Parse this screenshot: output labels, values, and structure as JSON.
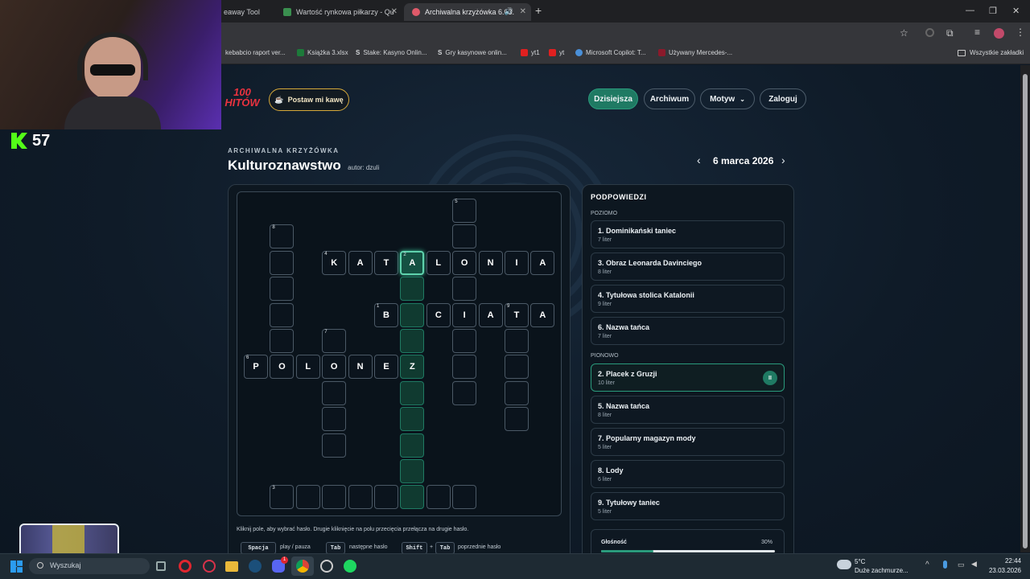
{
  "browser": {
    "tabs": [
      {
        "label": "eaway Tool",
        "color": "#6b7280"
      },
      {
        "label": "Wartość rynkowa piłkarzy - Qu",
        "color": "#3a8f4f"
      },
      {
        "label": "Archiwalna krzyżówka 6.03.",
        "color": "#e05a6a"
      }
    ],
    "new_tab": "+",
    "bookmarks": [
      {
        "label": "kebabcio raport ver...",
        "color": "#444"
      },
      {
        "label": "Książka 3.xlsx",
        "color": "#1d7a3a"
      },
      {
        "label": "Stake: Kasyno Onlin...",
        "color": "#555"
      },
      {
        "label": "Gry kasynowe onlin...",
        "color": "#555"
      },
      {
        "label": "yt1",
        "color": "#e02020"
      },
      {
        "label": "yt",
        "color": "#e02020"
      },
      {
        "label": "Microsoft Copilot: T...",
        "color": "#4a90d9"
      },
      {
        "label": "Używany Mercedes-...",
        "color": "#8b1a2b"
      }
    ],
    "all_bookmarks": "Wszystkie zakładki"
  },
  "stream": {
    "score": "57"
  },
  "header": {
    "logo": "100 HITÓW",
    "coffee": "Postaw mi kawę",
    "nav": [
      "Dzisiejsza",
      "Archiwum",
      "Motyw",
      "Zaloguj"
    ]
  },
  "puzzle": {
    "eyebrow": "ARCHIWALNA KRZYŻÓWKA",
    "title": "Kulturoznawstwo",
    "author": "autor: dzuli",
    "date": "6 marca 2026",
    "prev": "‹",
    "next": "›"
  },
  "grid": {
    "cells": [
      {
        "r": 0,
        "c": 8,
        "n": "5"
      },
      {
        "r": 1,
        "c": 1,
        "n": "8"
      },
      {
        "r": 1,
        "c": 8
      },
      {
        "r": 2,
        "c": 1
      },
      {
        "r": 2,
        "c": 3,
        "n": "4",
        "l": "K"
      },
      {
        "r": 2,
        "c": 4,
        "l": "A"
      },
      {
        "r": 2,
        "c": 5,
        "l": "T"
      },
      {
        "r": 2,
        "c": 6,
        "n": "2",
        "l": "A",
        "s": "sel"
      },
      {
        "r": 2,
        "c": 7,
        "l": "L"
      },
      {
        "r": 2,
        "c": 8,
        "l": "O"
      },
      {
        "r": 2,
        "c": 9,
        "l": "N"
      },
      {
        "r": 2,
        "c": 10,
        "l": "I"
      },
      {
        "r": 2,
        "c": 11,
        "l": "A"
      },
      {
        "r": 3,
        "c": 1
      },
      {
        "r": 3,
        "c": 6,
        "s": "hl"
      },
      {
        "r": 3,
        "c": 8
      },
      {
        "r": 4,
        "c": 1
      },
      {
        "r": 4,
        "c": 5,
        "n": "1",
        "l": "B"
      },
      {
        "r": 4,
        "c": 6,
        "s": "hl"
      },
      {
        "r": 4,
        "c": 7,
        "l": "C"
      },
      {
        "r": 4,
        "c": 8,
        "l": "I"
      },
      {
        "r": 4,
        "c": 9,
        "l": "A"
      },
      {
        "r": 4,
        "c": 10,
        "n": "9",
        "l": "T"
      },
      {
        "r": 4,
        "c": 11,
        "l": "A"
      },
      {
        "r": 5,
        "c": 1
      },
      {
        "r": 5,
        "c": 3,
        "n": "7"
      },
      {
        "r": 5,
        "c": 6,
        "s": "hl"
      },
      {
        "r": 5,
        "c": 8
      },
      {
        "r": 5,
        "c": 10
      },
      {
        "r": 6,
        "c": 0,
        "n": "6",
        "l": "P"
      },
      {
        "r": 6,
        "c": 1,
        "l": "O"
      },
      {
        "r": 6,
        "c": 2,
        "l": "L"
      },
      {
        "r": 6,
        "c": 3,
        "l": "O"
      },
      {
        "r": 6,
        "c": 4,
        "l": "N"
      },
      {
        "r": 6,
        "c": 5,
        "l": "E"
      },
      {
        "r": 6,
        "c": 6,
        "l": "Z",
        "s": "hl"
      },
      {
        "r": 6,
        "c": 8
      },
      {
        "r": 6,
        "c": 10
      },
      {
        "r": 7,
        "c": 3
      },
      {
        "r": 7,
        "c": 6,
        "s": "hl"
      },
      {
        "r": 7,
        "c": 8
      },
      {
        "r": 7,
        "c": 10
      },
      {
        "r": 8,
        "c": 3
      },
      {
        "r": 8,
        "c": 6,
        "s": "hl"
      },
      {
        "r": 8,
        "c": 10
      },
      {
        "r": 9,
        "c": 3
      },
      {
        "r": 9,
        "c": 6,
        "s": "hl"
      },
      {
        "r": 10,
        "c": 6,
        "s": "hl"
      },
      {
        "r": 11,
        "c": 1,
        "n": "3"
      },
      {
        "r": 11,
        "c": 2
      },
      {
        "r": 11,
        "c": 3
      },
      {
        "r": 11,
        "c": 4
      },
      {
        "r": 11,
        "c": 5
      },
      {
        "r": 11,
        "c": 6,
        "s": "hl"
      },
      {
        "r": 11,
        "c": 7
      },
      {
        "r": 11,
        "c": 8
      }
    ]
  },
  "instructions": "Kliknij pole, aby wybrać hasło. Drugie kliknięcie na polu przecięcia przełącza na drugie hasło.",
  "shortcuts": [
    {
      "keys": [
        "Spacja"
      ],
      "label": "play / pauza"
    },
    {
      "keys": [
        "Tab"
      ],
      "label": "następne hasło"
    },
    {
      "keys": [
        "Shift",
        "Tab"
      ],
      "label": "poprzednie hasło"
    }
  ],
  "plus": "+",
  "clues": {
    "heading": "PODPOWIEDZI",
    "across_label": "POZIOMO",
    "down_label": "PIONOWO",
    "across": [
      {
        "title": "1. Dominikański taniec",
        "sub": "7 liter"
      },
      {
        "title": "3. Obraz Leonarda Davinciego",
        "sub": "8 liter"
      },
      {
        "title": "4. Tytułowa stolica Katalonii",
        "sub": "9 liter"
      },
      {
        "title": "6. Nazwa tańca",
        "sub": "7 liter"
      }
    ],
    "down": [
      {
        "title": "2. Placek z Gruzji",
        "sub": "10 liter"
      },
      {
        "title": "5. Nazwa tańca",
        "sub": "8 liter"
      },
      {
        "title": "7. Popularny magazyn mody",
        "sub": "5 liter"
      },
      {
        "title": "8. Lody",
        "sub": "6 liter"
      },
      {
        "title": "9. Tytułowy taniec",
        "sub": "5 liter"
      }
    ],
    "pause_icon": "II"
  },
  "volume": {
    "label": "Głośność",
    "value": "30%",
    "level": 0.3
  },
  "taskbar": {
    "search": "Wyszukaj",
    "weather_temp": "5°C",
    "weather_desc": "Duże zachmurze...",
    "time": "22:44",
    "date": "23.03.2026",
    "badge": "1"
  },
  "colors": {
    "accent": "#1f7a63",
    "highlight": "#5fd2ad",
    "gold": "#d6a93a"
  }
}
